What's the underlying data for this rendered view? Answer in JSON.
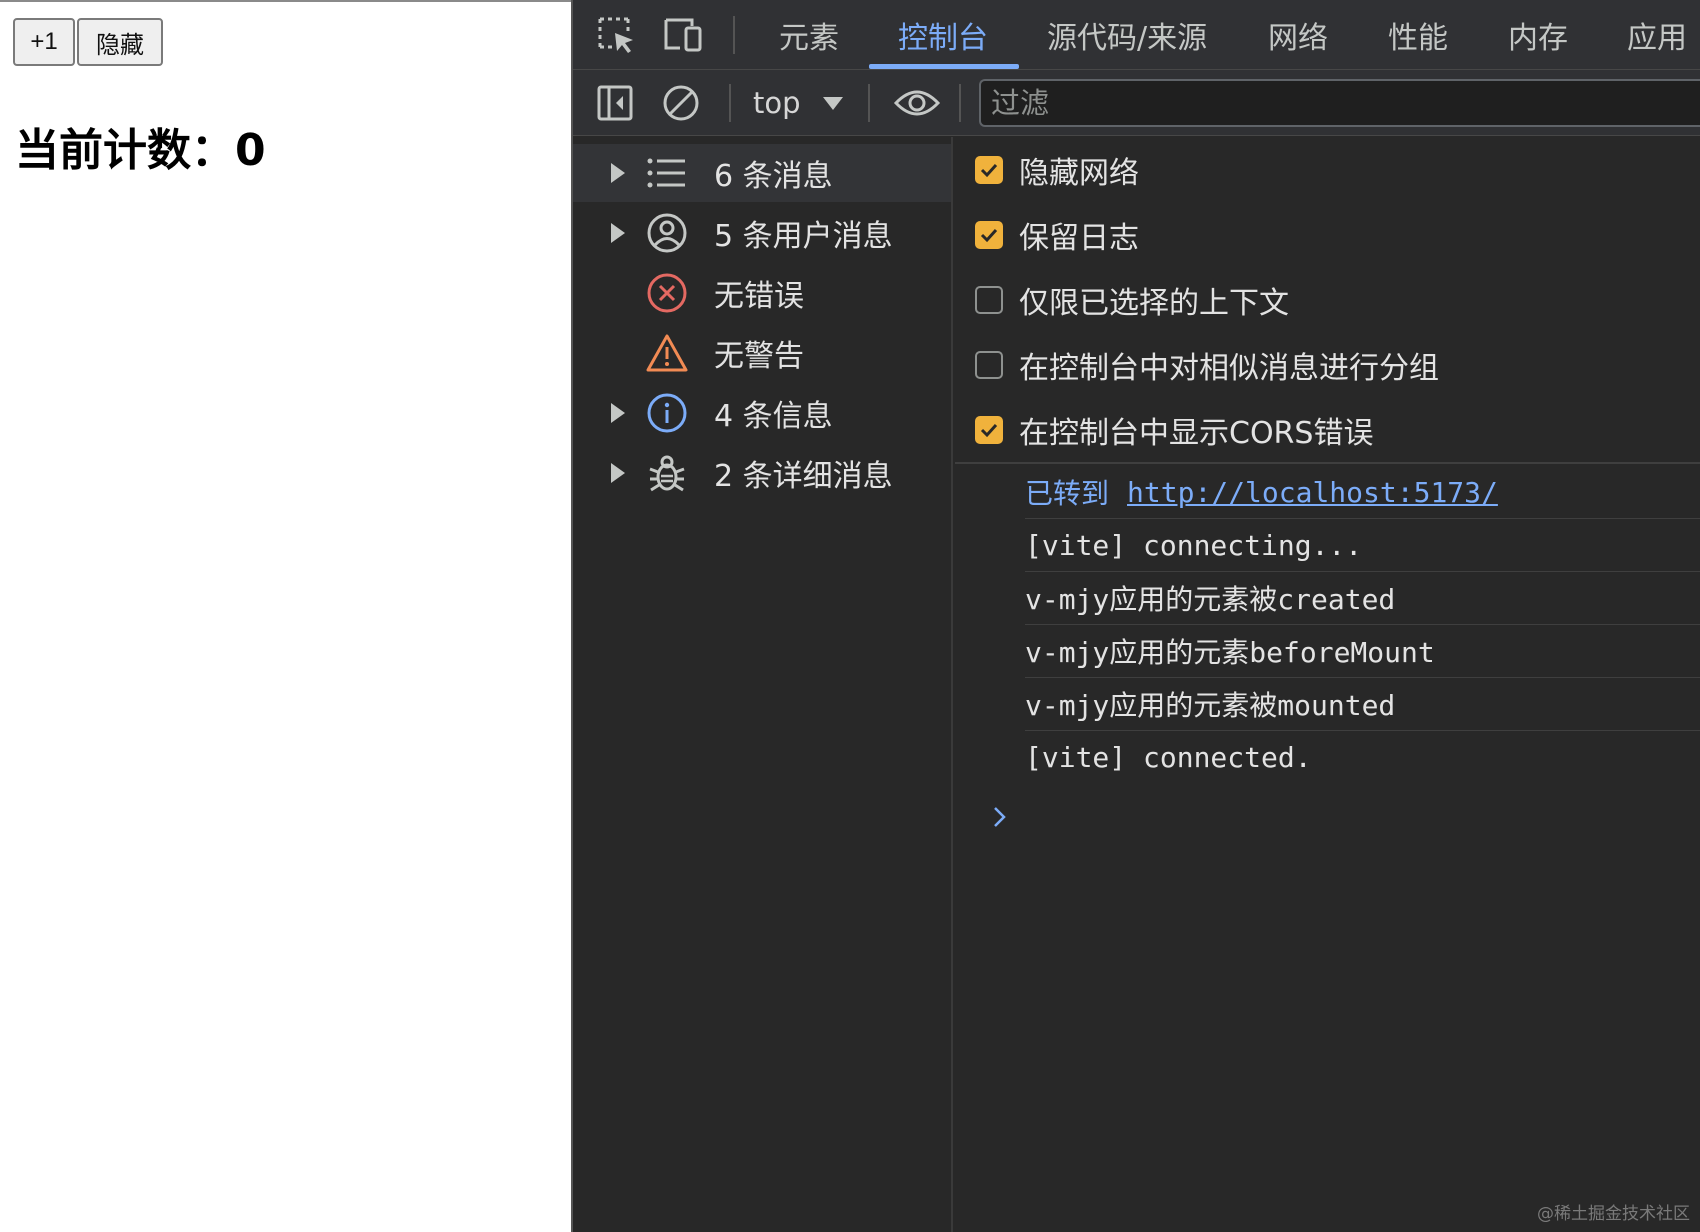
{
  "page": {
    "increment_button": "+1",
    "hide_button": "隐藏",
    "heading": "当前计数：0"
  },
  "devtools": {
    "tabs": [
      "元素",
      "控制台",
      "源代码/来源",
      "网络",
      "性能",
      "内存",
      "应用"
    ],
    "active_tab": "控制台",
    "context": "top",
    "filter_placeholder": "过滤",
    "sidebar": [
      {
        "label": "6 条消息",
        "icon": "list-icon",
        "expandable": true,
        "selected": true
      },
      {
        "label": "5 条用户消息",
        "icon": "user-icon",
        "expandable": true,
        "selected": false
      },
      {
        "label": "无错误",
        "icon": "error-icon",
        "expandable": false,
        "selected": false
      },
      {
        "label": "无警告",
        "icon": "warning-icon",
        "expandable": false,
        "selected": false
      },
      {
        "label": "4 条信息",
        "icon": "info-icon",
        "expandable": true,
        "selected": false
      },
      {
        "label": "2 条详细消息",
        "icon": "bug-icon",
        "expandable": true,
        "selected": false
      }
    ],
    "settings": [
      {
        "label": "隐藏网络",
        "checked": true
      },
      {
        "label": "保留日志",
        "checked": true
      },
      {
        "label": "仅限已选择的上下文",
        "checked": false
      },
      {
        "label": "在控制台中对相似消息进行分组",
        "checked": false
      },
      {
        "label": "在控制台中显示CORS错误",
        "checked": true
      }
    ],
    "console": {
      "navigated_prefix": "已转到",
      "navigated_url": "http://localhost:5173/",
      "messages": [
        "[vite] connecting...",
        "v-mjy应用的元素被created",
        "v-mjy应用的元素beforeMount",
        "v-mjy应用的元素被mounted",
        "[vite] connected."
      ]
    },
    "colors": {
      "accent": "#7cacf8",
      "checkbox": "#f0b23c",
      "error": "#e46962",
      "warning": "#f28b54"
    }
  },
  "watermark": "@稀土掘金技术社区"
}
